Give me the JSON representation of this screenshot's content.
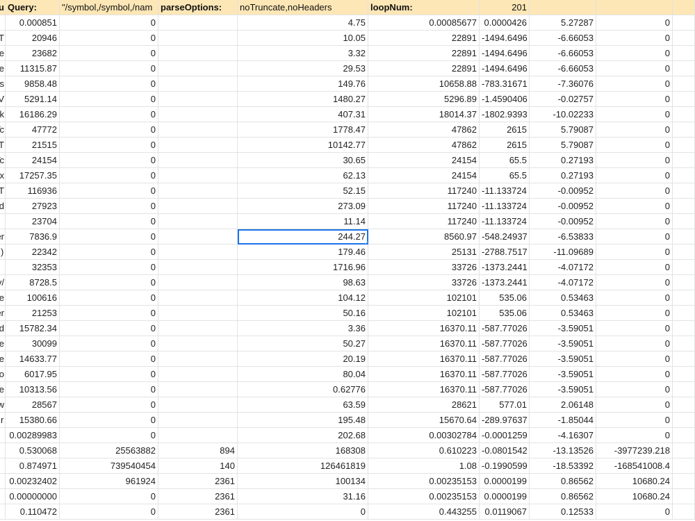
{
  "header": [
    "Qu",
    "Query:",
    "\"/symbol,/symbol,/nam",
    "parseOptions:",
    "noTruncate,noHeaders",
    "loopNum:",
    "201",
    "",
    "",
    ""
  ],
  "rows": [
    [
      "",
      "0.000851",
      "0",
      "",
      "4.75",
      "0.00085677",
      "0.0000426",
      "5.27287",
      "0",
      ""
    ],
    [
      "T",
      "20946",
      "0",
      "",
      "10.05",
      "22891",
      "-1494.6496",
      "-6.66053",
      "0",
      ""
    ],
    [
      "de",
      "23682",
      "0",
      "",
      "3.32",
      "22891",
      "-1494.6496",
      "-6.66053",
      "0",
      ""
    ],
    [
      "Te",
      "11315.87",
      "0",
      "",
      "29.53",
      "22891",
      "-1494.6496",
      "-6.66053",
      "0",
      ""
    ],
    [
      "ıs",
      "9858.48",
      "0",
      "",
      "149.76",
      "10658.88",
      "-783.31671",
      "-7.36076",
      "0",
      ""
    ],
    [
      "V",
      "5291.14",
      "0",
      "",
      "1480.27",
      "5296.89",
      "-1.4590406",
      "-0.02757",
      "0",
      ""
    ],
    [
      "k",
      "16186.29",
      "0",
      "",
      "407.31",
      "18014.37",
      "-1802.9393",
      "-10.02233",
      "0",
      ""
    ],
    [
      "Tc",
      "47772",
      "0",
      "",
      "1778.47",
      "47862",
      "2615",
      "5.79087",
      "0",
      ""
    ],
    [
      "T",
      "21515",
      "0",
      "",
      "10142.77",
      "47862",
      "2615",
      "5.79087",
      "0",
      ""
    ],
    [
      "Tc",
      "24154",
      "0",
      "",
      "30.65",
      "24154",
      "65.5",
      "0.27193",
      "0",
      ""
    ],
    [
      "x",
      "17257.35",
      "0",
      "",
      "62.13",
      "24154",
      "65.5",
      "0.27193",
      "0",
      ""
    ],
    [
      "T",
      "116936",
      "0",
      "",
      "52.15",
      "117240",
      "-11.133724",
      "-0.00952",
      "0",
      ""
    ],
    [
      "d",
      "27923",
      "0",
      "",
      "273.09",
      "117240",
      "-11.133724",
      "-0.00952",
      "0",
      ""
    ],
    [
      "",
      "23704",
      "0",
      "",
      "11.14",
      "117240",
      "-11.133724",
      "-0.00952",
      "0",
      ""
    ],
    [
      "er",
      "7836.9",
      "0",
      "",
      "244.27",
      "8560.97",
      "-548.24937",
      "-6.53833",
      "0",
      ""
    ],
    [
      "(",
      "22342",
      "0",
      "",
      "179.46",
      "25131",
      "-2788.7517",
      "-11.09689",
      "0",
      ""
    ],
    [
      "",
      "32353",
      "0",
      "",
      "1716.96",
      "33726",
      "-1373.2441",
      "-4.07172",
      "0",
      ""
    ],
    [
      "/v",
      "8728.5",
      "0",
      "",
      "98.63",
      "33726",
      "-1373.2441",
      "-4.07172",
      "0",
      ""
    ],
    [
      "e",
      "100616",
      "0",
      "",
      "104.12",
      "102101",
      "535.06",
      "0.53463",
      "0",
      ""
    ],
    [
      "er",
      "21253",
      "0",
      "",
      "50.16",
      "102101",
      "535.06",
      "0.53463",
      "0",
      ""
    ],
    [
      "d",
      "15782.34",
      "0",
      "",
      "3.36",
      "16370.11",
      "-587.77026",
      "-3.59051",
      "0",
      ""
    ],
    [
      "ne",
      "30099",
      "0",
      "",
      "50.27",
      "16370.11",
      "-587.77026",
      "-3.59051",
      "0",
      ""
    ],
    [
      "ke",
      "14633.77",
      "0",
      "",
      "20.19",
      "16370.11",
      "-587.77026",
      "-3.59051",
      "0",
      ""
    ],
    [
      "lo",
      "6017.95",
      "0",
      "",
      "80.04",
      "16370.11",
      "-587.77026",
      "-3.59051",
      "0",
      ""
    ],
    [
      "e",
      "10313.56",
      "0",
      "",
      "0.62776",
      "16370.11",
      "-587.77026",
      "-3.59051",
      "0",
      ""
    ],
    [
      "w",
      "28567",
      "0",
      "",
      "63.59",
      "28621",
      "577.01",
      "2.06148",
      "0",
      ""
    ],
    [
      "r",
      "15380.66",
      "0",
      "",
      "195.48",
      "15670.64",
      "-289.97637",
      "-1.85044",
      "0",
      ""
    ],
    [
      "",
      "0.00289983",
      "0",
      "",
      "202.68",
      "0.00302784",
      "-0.0001259",
      "-4.16307",
      "0",
      ""
    ],
    [
      "",
      "0.530068",
      "25563882",
      "894",
      "168308",
      "0.610223",
      "-0.0801542",
      "-13.13526",
      "-3977239.218",
      ""
    ],
    [
      "",
      "0.874971",
      "739540454",
      "140",
      "126461819",
      "1.08",
      "-0.1990599",
      "-18.53392",
      "-168541008.4",
      ""
    ],
    [
      "",
      "0.00232402",
      "961924",
      "2361",
      "100134",
      "0.00235153",
      "0.0000199",
      "0.86562",
      "10680.24",
      ""
    ],
    [
      "",
      "0.00000000",
      "0",
      "2361",
      "31.16",
      "0.00235153",
      "0.0000199",
      "0.86562",
      "10680.24",
      ""
    ],
    [
      "",
      "0.110472",
      "0",
      "2361",
      "0",
      "0.443255",
      "0.0119067",
      "0.12533",
      "0",
      ""
    ]
  ],
  "selected_cell": {
    "row": 14,
    "col": 4
  }
}
